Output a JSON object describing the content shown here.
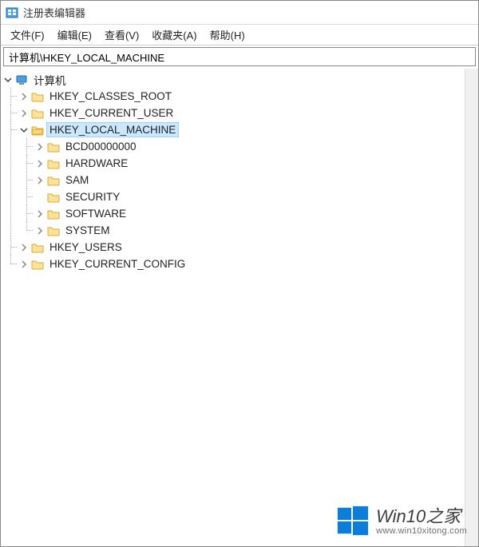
{
  "window": {
    "title": "注册表编辑器"
  },
  "menu": {
    "file": "文件(F)",
    "edit": "编辑(E)",
    "view": "查看(V)",
    "favorites": "收藏夹(A)",
    "help": "帮助(H)"
  },
  "addressbar": {
    "value": "计算机\\HKEY_LOCAL_MACHINE"
  },
  "tree": {
    "root": {
      "label": "计算机",
      "expanded": true,
      "children": [
        {
          "label": "HKEY_CLASSES_ROOT",
          "expanded": false
        },
        {
          "label": "HKEY_CURRENT_USER",
          "expanded": false
        },
        {
          "label": "HKEY_LOCAL_MACHINE",
          "expanded": true,
          "selected": true,
          "children": [
            {
              "label": "BCD00000000",
              "expanded": false
            },
            {
              "label": "HARDWARE",
              "expanded": false
            },
            {
              "label": "SAM",
              "expanded": false
            },
            {
              "label": "SECURITY",
              "leaf": true
            },
            {
              "label": "SOFTWARE",
              "expanded": false
            },
            {
              "label": "SYSTEM",
              "expanded": false
            }
          ]
        },
        {
          "label": "HKEY_USERS",
          "expanded": false
        },
        {
          "label": "HKEY_CURRENT_CONFIG",
          "expanded": false
        }
      ]
    }
  },
  "watermark": {
    "line1": "Win10之家",
    "line2": "www.win10xitong.com"
  },
  "colors": {
    "selection_bg": "#cce8ff",
    "selection_border": "#99d1ff",
    "logo_blue": "#0078d7"
  }
}
